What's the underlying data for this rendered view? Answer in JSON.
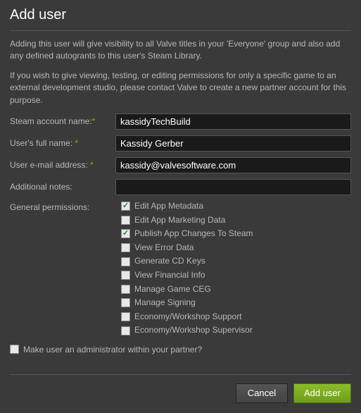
{
  "title": "Add user",
  "description1": "Adding this user will give visibility to all Valve titles in your 'Everyone' group and also add any defined autogrants to this user's Steam Library.",
  "description2": "If you wish to give viewing, testing, or editing permissions for only a specific game to an external development studio, please contact Valve to create a new partner account for this purpose.",
  "fields": {
    "steam_account": {
      "label": "Steam account name:",
      "required": "*",
      "value": "kassidyTechBuild"
    },
    "full_name": {
      "label": "User's full name: ",
      "required": "*",
      "value": "Kassidy Gerber"
    },
    "email": {
      "label": "User e-mail address: ",
      "required": "*",
      "value": "kassidy@valvesoftware.com"
    },
    "notes": {
      "label": "Additional notes:",
      "value": ""
    }
  },
  "permissions_label": "General permissions:",
  "permissions": [
    {
      "label": "Edit App Metadata",
      "checked": true
    },
    {
      "label": "Edit App Marketing Data",
      "checked": false
    },
    {
      "label": "Publish App Changes To Steam",
      "checked": true
    },
    {
      "label": "View Error Data",
      "checked": false
    },
    {
      "label": "Generate CD Keys",
      "checked": false
    },
    {
      "label": "View Financial Info",
      "checked": false
    },
    {
      "label": "Manage Game CEG",
      "checked": false
    },
    {
      "label": "Manage Signing",
      "checked": false
    },
    {
      "label": "Economy/Workshop Support",
      "checked": false
    },
    {
      "label": "Economy/Workshop Supervisor",
      "checked": false
    }
  ],
  "admin_label": "Make user an administrator within your partner?",
  "admin_checked": false,
  "buttons": {
    "cancel": "Cancel",
    "submit": "Add user"
  }
}
